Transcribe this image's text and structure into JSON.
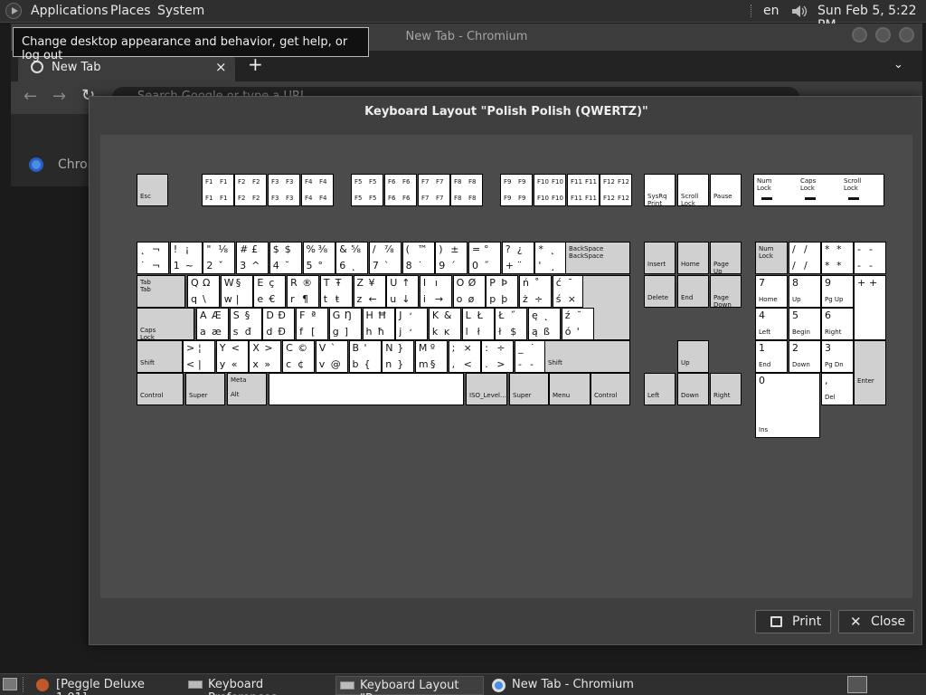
{
  "panel": {
    "applications": "Applications",
    "places": "Places",
    "system": "System",
    "lang": "en",
    "clock": "Sun Feb  5,  5:22 PM"
  },
  "tooltip": "Change desktop appearance and behavior, get help, or log out",
  "browser": {
    "window_title": "New Tab - Chromium",
    "tab_title": "New Tab",
    "omnibox_placeholder": "Search Google or type a URL",
    "shortcut_label": "Chrom"
  },
  "dialog": {
    "title": "Keyboard Layout \"Polish Polish (QWERTZ)\"",
    "print": "Print",
    "close": "Close"
  },
  "taskbar": [
    {
      "label": "[Peggle Deluxe 1.01]"
    },
    {
      "label": "Keyboard Preferences"
    },
    {
      "label": "Keyboard Layout \"P..."
    },
    {
      "label": "New Tab - Chromium"
    }
  ],
  "keyboard": {
    "esc": "Esc",
    "fkeys": [
      {
        "t": "F1",
        "t2": "F1",
        "b": "F1",
        "b2": "F1"
      },
      {
        "t": "F2",
        "t2": "F2",
        "b": "F2",
        "b2": "F2"
      },
      {
        "t": "F3",
        "t2": "F3",
        "b": "F3",
        "b2": "F3"
      },
      {
        "t": "F4",
        "t2": "F4",
        "b": "F4",
        "b2": "F4"
      },
      {
        "t": "F5",
        "t2": "F5",
        "b": "F5",
        "b2": "F5"
      },
      {
        "t": "F6",
        "t2": "F6",
        "b": "F6",
        "b2": "F6"
      },
      {
        "t": "F7",
        "t2": "F7",
        "b": "F7",
        "b2": "F7"
      },
      {
        "t": "F8",
        "t2": "F8",
        "b": "F8",
        "b2": "F8"
      },
      {
        "t": "F9",
        "t2": "F9",
        "b": "F9",
        "b2": "F9"
      },
      {
        "t": "F10",
        "t2": "F10",
        "b": "F10",
        "b2": "F10"
      },
      {
        "t": "F11",
        "t2": "F11",
        "b": "F11",
        "b2": "F11"
      },
      {
        "t": "F12",
        "t2": "F12",
        "b": "F12",
        "b2": "F12"
      }
    ],
    "sysrq": "SysRq\nPrint",
    "scroll_lock": "Scroll\nLock",
    "pause": "Pause",
    "leds": [
      "Num\nLock",
      "Caps\nLock",
      "Scroll\nLock"
    ],
    "row1": [
      {
        "t": "˛",
        "t2": "¬",
        "b": "˙",
        "b2": "¬"
      },
      {
        "t": "!",
        "t2": "¡",
        "b": "1",
        "b2": "~"
      },
      {
        "t": "\"",
        "t2": "⅛",
        "b": "2",
        "b2": "ˇ"
      },
      {
        "t": "#",
        "t2": "£",
        "b": "3",
        "b2": "^"
      },
      {
        "t": "$",
        "t2": "$",
        "b": "4",
        "b2": "˘"
      },
      {
        "t": "%",
        "t2": "⅜",
        "b": "5",
        "b2": "°"
      },
      {
        "t": "&",
        "t2": "⅝",
        "b": "6",
        "b2": "˛"
      },
      {
        "t": "/",
        "t2": "⅞",
        "b": "7",
        "b2": "`"
      },
      {
        "t": "(",
        "t2": "™",
        "b": "8",
        "b2": "˙"
      },
      {
        "t": ")",
        "t2": "±",
        "b": "9",
        "b2": "´"
      },
      {
        "t": "=",
        "t2": "°",
        "b": "0",
        "b2": "˝"
      },
      {
        "t": "?",
        "t2": "¿",
        "b": "+",
        "b2": "¨"
      },
      {
        "t": "*",
        "t2": "˛",
        "b": "'",
        "b2": "¸"
      }
    ],
    "backspace": "BackSpace\nBackSpace",
    "tab": "Tab\nTab",
    "row2": [
      {
        "t": "Q",
        "t2": "Ω",
        "b": "q",
        "b2": "\\"
      },
      {
        "t": "W",
        "t2": "§",
        "b": "w",
        "b2": "|"
      },
      {
        "t": "E",
        "t2": "ç",
        "b": "e",
        "b2": "€"
      },
      {
        "t": "R",
        "t2": "®",
        "b": "r",
        "b2": "¶"
      },
      {
        "t": "T",
        "t2": "Ŧ",
        "b": "t",
        "b2": "ŧ"
      },
      {
        "t": "Z",
        "t2": "¥",
        "b": "z",
        "b2": "←"
      },
      {
        "t": "U",
        "t2": "↑",
        "b": "u",
        "b2": "↓"
      },
      {
        "t": "I",
        "t2": "ı",
        "b": "i",
        "b2": "→"
      },
      {
        "t": "O",
        "t2": "Ø",
        "b": "o",
        "b2": "ø"
      },
      {
        "t": "P",
        "t2": "Þ",
        "b": "p",
        "b2": "þ"
      },
      {
        "t": "ń",
        "t2": "˚",
        "b": "ż",
        "b2": "÷"
      },
      {
        "t": "ć",
        "t2": "¯",
        "b": "ś",
        "b2": "×"
      }
    ],
    "return": "Return",
    "caps": "Caps\nLock",
    "row3": [
      {
        "t": "A",
        "t2": "Æ",
        "b": "a",
        "b2": "æ"
      },
      {
        "t": "S",
        "t2": "§",
        "b": "s",
        "b2": "đ"
      },
      {
        "t": "D",
        "t2": "Đ",
        "b": "d",
        "b2": "Đ"
      },
      {
        "t": "F",
        "t2": "ª",
        "b": "f",
        "b2": "["
      },
      {
        "t": "G",
        "t2": "Ŋ",
        "b": "g",
        "b2": "]"
      },
      {
        "t": "H",
        "t2": "Ħ",
        "b": "h",
        "b2": "ħ"
      },
      {
        "t": "J",
        "t2": "̛",
        "b": "j",
        "b2": "̛"
      },
      {
        "t": "K",
        "t2": "&",
        "b": "k",
        "b2": "ĸ"
      },
      {
        "t": "L",
        "t2": "Ł",
        "b": "l",
        "b2": "ł"
      },
      {
        "t": "Ł",
        "t2": "˝",
        "b": "ł",
        "b2": "$"
      },
      {
        "t": "ę",
        "t2": "˛",
        "b": "ą",
        "b2": "ß"
      },
      {
        "t": "ź",
        "t2": "˘",
        "b": "ó",
        "b2": "'"
      }
    ],
    "lshift": "Shift",
    "row4": [
      {
        "t": ">",
        "t2": "¦",
        "b": "<",
        "b2": "|"
      },
      {
        "t": "Y",
        "t2": "<",
        "b": "y",
        "b2": "«"
      },
      {
        "t": "X",
        "t2": ">",
        "b": "x",
        "b2": "»"
      },
      {
        "t": "C",
        "t2": "©",
        "b": "c",
        "b2": "¢"
      },
      {
        "t": "V",
        "t2": "`",
        "b": "v",
        "b2": "@"
      },
      {
        "t": "B",
        "t2": "'",
        "b": "b",
        "b2": "{"
      },
      {
        "t": "N",
        "t2": "}",
        "b": "n",
        "b2": "}"
      },
      {
        "t": "M",
        "t2": "º",
        "b": "m",
        "b2": "§"
      },
      {
        "t": ";",
        "t2": "×",
        "b": ",",
        "b2": "<"
      },
      {
        "t": ":",
        "t2": "÷",
        "b": ".",
        "b2": ">"
      },
      {
        "t": "_",
        "t2": "˙",
        "b": "-",
        "b2": "-"
      }
    ],
    "rshift": "Shift",
    "bottom": [
      {
        "label": "Control"
      },
      {
        "label": "Super"
      },
      {
        "label": "Meta\n\nAlt"
      },
      {
        "label": ""
      },
      {
        "label": "ISO_Level..."
      },
      {
        "label": "Super"
      },
      {
        "label": "Menu"
      },
      {
        "label": "Control"
      }
    ],
    "nav": [
      "Insert",
      "Home",
      "Page\nUp",
      "Delete",
      "End",
      "Page\nDown"
    ],
    "arrows": [
      "Up",
      "Left",
      "Down",
      "Right"
    ],
    "numpad": [
      {
        "t": "Num\nLock",
        "mod": true
      },
      {
        "t": "/",
        "t2": "/",
        "b": "/",
        "b2": "/"
      },
      {
        "t": "*",
        "t2": "*",
        "b": "*",
        "b2": "*"
      },
      {
        "t": "-",
        "t2": "-",
        "b": "-",
        "b2": "-"
      },
      {
        "t": "7",
        "b": "Home"
      },
      {
        "t": "8",
        "b": "Up"
      },
      {
        "t": "9",
        "b": "Pg Up"
      },
      {
        "t": "+",
        "t2": "+"
      },
      {
        "t": "4",
        "b": "Left"
      },
      {
        "t": "5",
        "b": "Begin"
      },
      {
        "t": "6",
        "b": "Right"
      },
      {
        "t": "+",
        "t2": "+"
      },
      {
        "t": "1",
        "b": "End"
      },
      {
        "t": "2",
        "b": "Down"
      },
      {
        "t": "3",
        "b": "Pg Dn"
      },
      {
        "t": "Enter",
        "mod": true
      },
      {
        "t": "0",
        "b": "Ins"
      },
      {
        "t": ",",
        "b": "Del"
      }
    ]
  }
}
